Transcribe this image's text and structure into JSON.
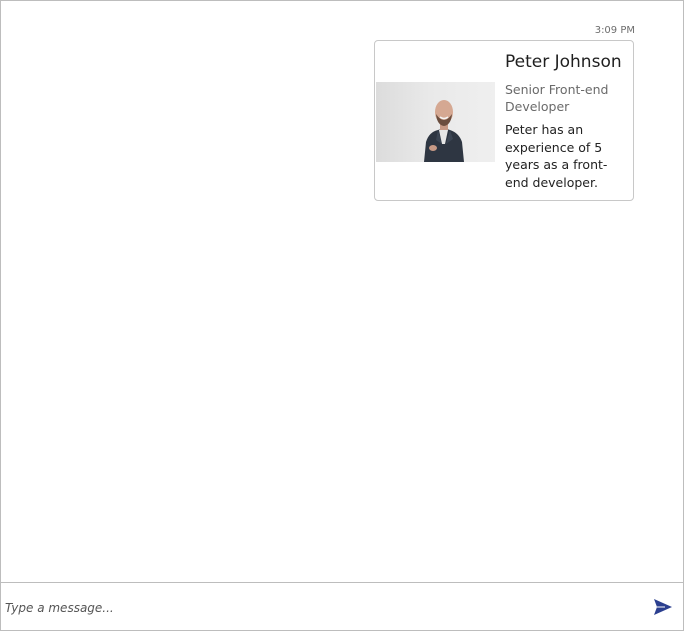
{
  "conversation": {
    "messages": [
      {
        "timestamp": "3:09 PM",
        "card": {
          "image_icon": "portrait-photo",
          "title": "Peter Johnson",
          "subtitle": "Senior Front-end Developer",
          "text": "Peter has an experience of 5 years as a front-end developer."
        }
      }
    ]
  },
  "composer": {
    "placeholder": "Type a message...",
    "value": "",
    "send_icon": "send-icon"
  },
  "colors": {
    "accent": "#2b3f8f",
    "border": "#bdbdbd",
    "card_border": "#c8c8c8"
  }
}
